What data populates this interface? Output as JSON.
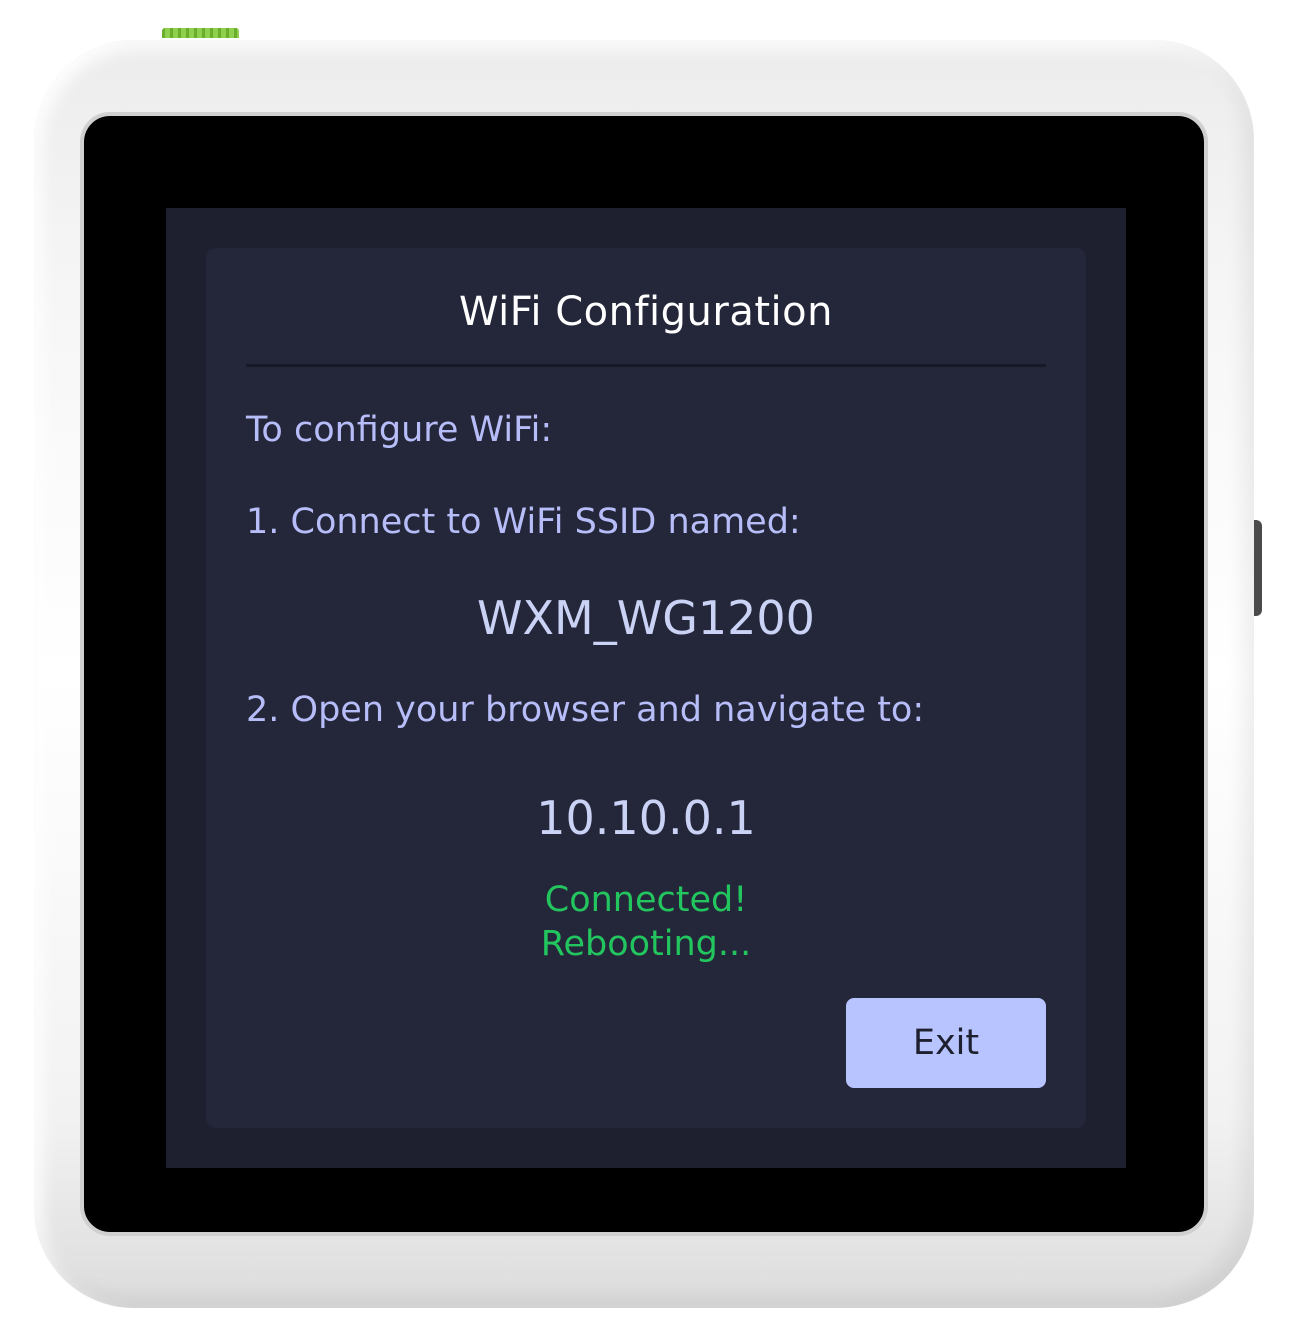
{
  "dialog": {
    "title": "WiFi Configuration",
    "intro": "To configure WiFi:",
    "step1": "1. Connect to WiFi SSID named:",
    "ssid": "WXM_WG1200",
    "step2": "2. Open your browser and navigate to:",
    "address": "10.10.0.1",
    "status_line1": "Connected!",
    "status_line2": "Rebooting...",
    "exit_label": "Exit"
  },
  "colors": {
    "screen_bg": "#1e2030",
    "panel_bg": "#24273a",
    "instruction_text": "#b7bdf8",
    "status_text": "#22c55e",
    "button_bg": "#b7c4ff"
  }
}
